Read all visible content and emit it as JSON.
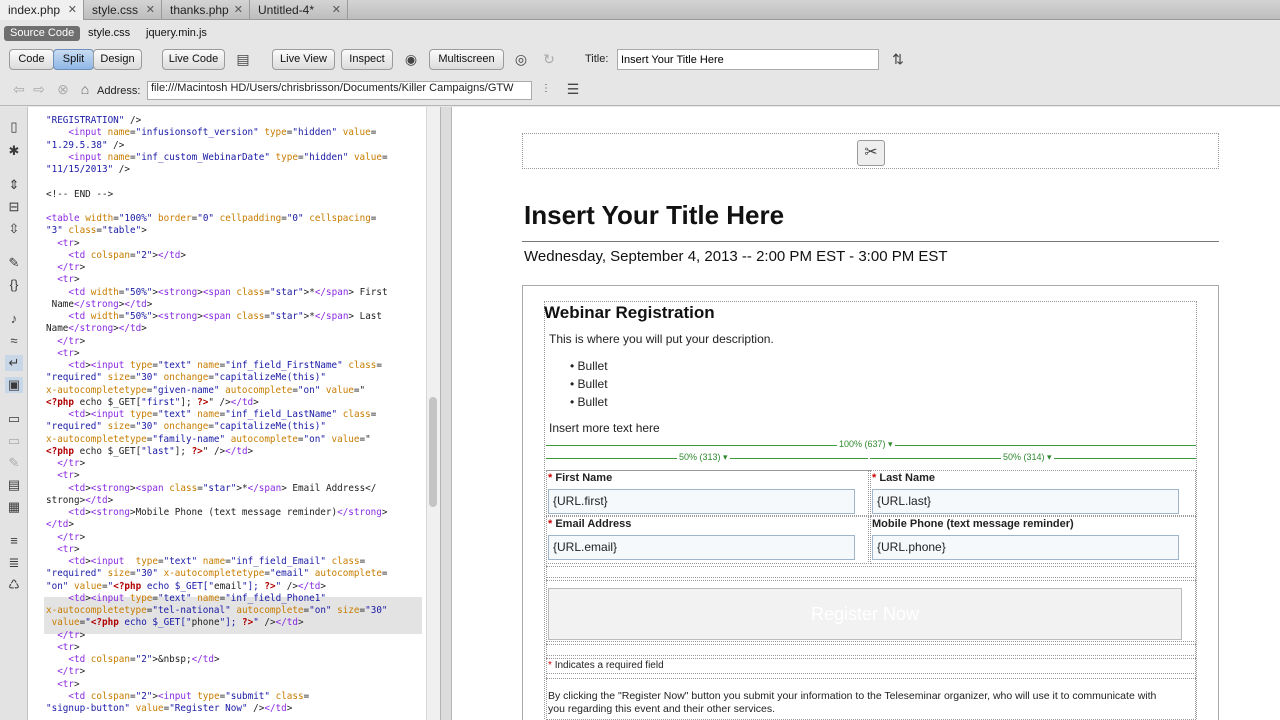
{
  "doc_tabs": [
    {
      "label": "index.php"
    },
    {
      "label": "style.css"
    },
    {
      "label": "thanks.php"
    },
    {
      "label": "Untitled-4*"
    }
  ],
  "related_files": [
    "Source Code",
    "style.css",
    "jquery.min.js"
  ],
  "toolbar": {
    "code": "Code",
    "split": "Split",
    "design": "Design",
    "live_code": "Live Code",
    "live_view": "Live View",
    "inspect": "Inspect",
    "multiscreen": "Multiscreen",
    "title_label": "Title:",
    "title_value": "Insert Your Title Here"
  },
  "address": {
    "label": "Address:",
    "value": "file:///Macintosh HD/Users/chrisbrisson/Documents/Killer Campaigns/GTW"
  },
  "code_lines": [
    "\"REGISTRATION\" />",
    "    <input name=\"infusionsoft_version\" type=\"hidden\" value=",
    "\"1.29.5.38\" />",
    "    <input name=\"inf_custom_WebinarDate\" type=\"hidden\" value=",
    "\"11/15/2013\" />",
    "",
    "<!-- END -->",
    "",
    "<table width=\"100%\" border=\"0\" cellpadding=\"0\" cellspacing=",
    "\"3\" class=\"table\">",
    "  <tr>",
    "    <td colspan=\"2\"></td>",
    "  </tr>",
    "  <tr>",
    "    <td width=\"50%\"><strong><span class=\"star\">*</span> First",
    " Name</strong></td>",
    "    <td width=\"50%\"><strong><span class=\"star\">*</span> Last",
    "Name</strong></td>",
    "  </tr>",
    "  <tr>",
    "    <td><input type=\"text\" name=\"inf_field_FirstName\" class=",
    "\"required\" size=\"30\" onchange=\"capitalizeMe(this)\"",
    "x-autocompletetype=\"given-name\" autocomplete=\"on\" value=\"",
    "<?php echo $_GET[\"first\"]; ?>\" /></td>",
    "    <td><input type=\"text\" name=\"inf_field_LastName\" class=",
    "\"required\" size=\"30\" onchange=\"capitalizeMe(this)\"",
    "x-autocompletetype=\"family-name\" autocomplete=\"on\" value=\"",
    "<?php echo $_GET[\"last\"]; ?>\" /></td>",
    "  </tr>",
    "  <tr>",
    "    <td><strong><span class=\"star\">*</span> Email Address</",
    "strong></td>",
    "    <td><strong>Mobile Phone (text message reminder)</strong>",
    "</td>",
    "  </tr>",
    "  <tr>",
    "    <td><input  type=\"text\" name=\"inf_field_Email\" class=",
    "\"required\" size=\"30\" x-autocompletetype=\"email\" autocomplete=",
    "\"on\" value=\"<?php echo $_GET[\"email\"]; ?>\" /></td>",
    "    <td><input type=\"text\" name=\"inf_field_Phone1\"",
    "x-autocompletetype=\"tel-national\" autocomplete=\"on\" size=\"30\"",
    " value=\"<?php echo $_GET[\"phone\"]; ?>\" /></td>",
    "  </tr>",
    "  <tr>",
    "    <td colspan=\"2\">&nbsp;</td>",
    "  </tr>",
    "  <tr>",
    "    <td colspan=\"2\"><input type=\"submit\" class=",
    "\"signup-button\" value=\"Register Now\" /></td>"
  ],
  "page": {
    "title": "Insert Your Title Here",
    "date": "Wednesday, September 4, 2013 -- 2:00 PM EST - 3:00 PM EST",
    "heading": "Webinar Registration",
    "description": "This is where you will put your description.",
    "bullets": [
      "Bullet",
      "Bullet",
      "Bullet"
    ],
    "more_text": "Insert more text here",
    "table_width": "100% (637) ▾",
    "col1_width": "50% (313) ▾",
    "col2_width": "50% (314) ▾",
    "first_label": "First Name",
    "last_label": "Last Name",
    "first_value": "{URL.first}",
    "last_value": "{URL.last}",
    "email_label": "Email Address",
    "phone_label": "Mobile Phone (text message reminder)",
    "email_value": "{URL.email}",
    "phone_value": "{URL.phone}",
    "register": "Register Now",
    "required_note": "Indicates a required field",
    "disclaimer_1": "By clicking the \"Register Now\" button you submit your information to the Teleseminar organizer, who will use it to communicate with",
    "disclaimer_2": "you regarding this event and their other services."
  }
}
